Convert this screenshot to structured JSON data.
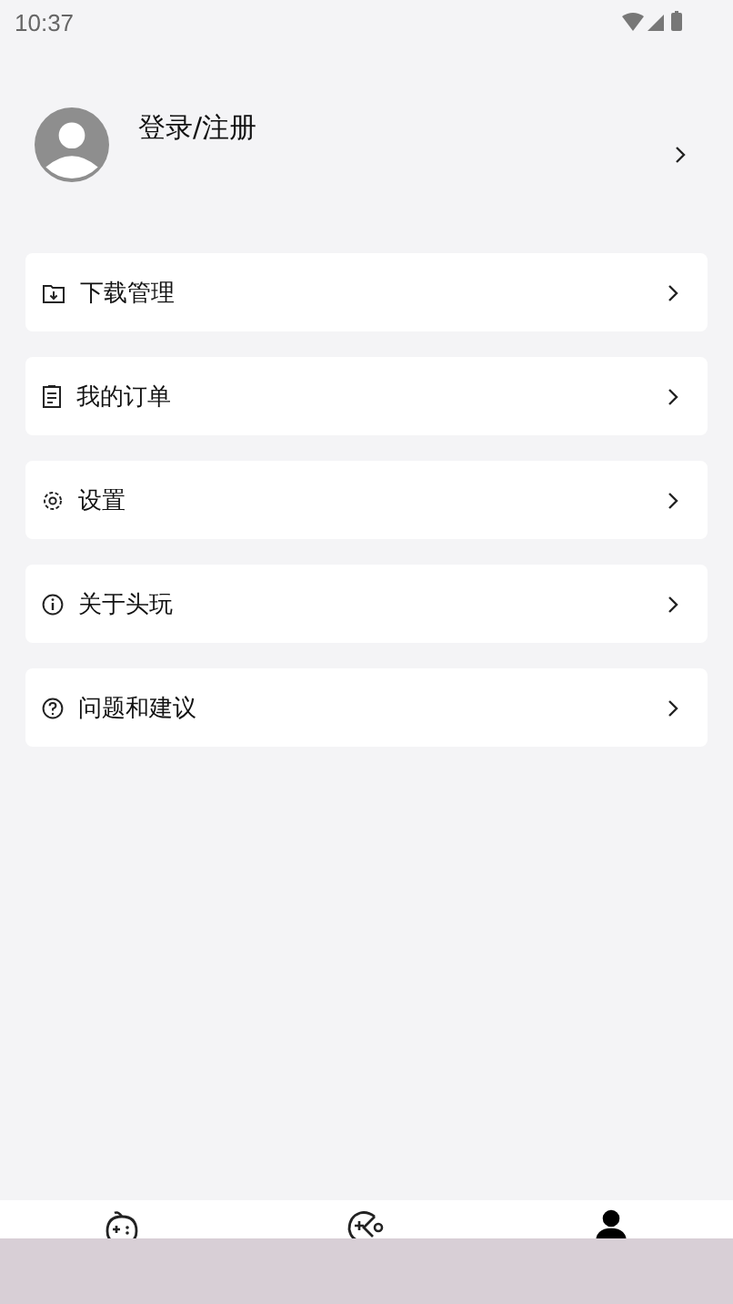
{
  "status_bar": {
    "time": "10:37"
  },
  "profile": {
    "label": "登录/注册"
  },
  "menu": [
    {
      "kind": "download",
      "label": "下载管理"
    },
    {
      "kind": "orders",
      "label": "我的订单"
    },
    {
      "kind": "settings",
      "label": "设置"
    },
    {
      "kind": "about",
      "label": "关于头玩"
    },
    {
      "kind": "help",
      "label": "问题和建议"
    }
  ],
  "bottom_nav": [
    {
      "kind": "home",
      "selected": false
    },
    {
      "kind": "games",
      "selected": false
    },
    {
      "kind": "me",
      "selected": true
    }
  ]
}
